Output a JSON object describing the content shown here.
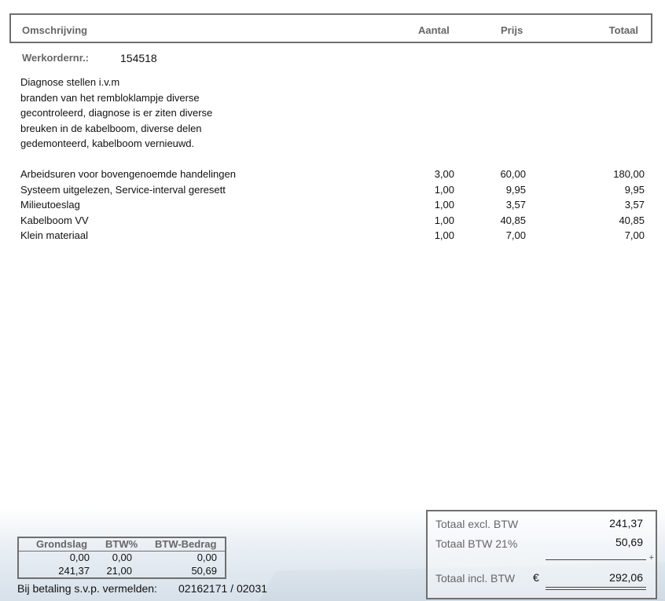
{
  "header": {
    "description": "Omschrijving",
    "quantity": "Aantal",
    "price": "Prijs",
    "total": "Totaal"
  },
  "work_order": {
    "label": "Werkordernr.:",
    "value": "154518"
  },
  "description_lines": [
    "Diagnose stellen i.v.m",
    "branden van het rembloklampje diverse",
    "gecontroleerd, diagnose is er ziten diverse",
    "breuken in de kabelboom, diverse delen",
    "gedemonteerd, kabelboom vernieuwd."
  ],
  "lines": [
    {
      "description": "Arbeidsuren voor bovengenoemde handelingen",
      "qty": "3,00",
      "price": "60,00",
      "total": "180,00"
    },
    {
      "description": "Systeem uitgelezen, Service-interval geresett",
      "qty": "1,00",
      "price": "9,95",
      "total": "9,95"
    },
    {
      "description": "Milieutoeslag",
      "qty": "1,00",
      "price": "3,57",
      "total": "3,57"
    },
    {
      "description": "Kabelboom VV",
      "qty": "1,00",
      "price": "40,85",
      "total": "40,85"
    },
    {
      "description": "Klein materiaal",
      "qty": "1,00",
      "price": "7,00",
      "total": "7,00"
    }
  ],
  "vat_table": {
    "headers": [
      "Grondslag",
      "BTW%",
      "BTW-Bedrag"
    ],
    "rows": [
      [
        "0,00",
        "0,00",
        "0,00"
      ],
      [
        "241,37",
        "21,00",
        "50,69"
      ]
    ]
  },
  "payment": {
    "label": "Bij betaling s.v.p. vermelden:",
    "reference": "02162171 / 02031"
  },
  "totals": {
    "excl_label": "Totaal excl. BTW",
    "excl_value": "241,37",
    "btw_label": "Totaal BTW  21%",
    "btw_value": "50,69",
    "plus_sign": "+",
    "incl_label": "Totaal incl. BTW",
    "currency": "€",
    "incl_value": "292,06"
  }
}
